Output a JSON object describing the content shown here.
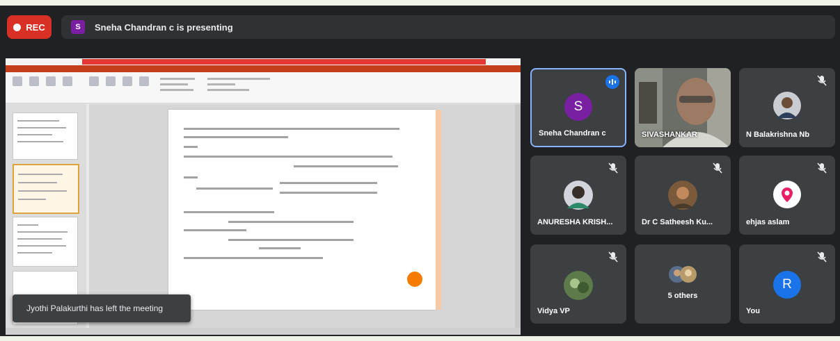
{
  "recording": {
    "label": "REC"
  },
  "presenting": {
    "avatar_initial": "S",
    "text": "Sneha Chandran c is presenting"
  },
  "notification": {
    "text": "Jyothi Palakurthi has left the meeting"
  },
  "participants": [
    {
      "name": "Sneha Chandran c",
      "initial": "S",
      "avatar_color": "#7b1fa2",
      "speaking": true
    },
    {
      "name": "SIVASHANKAR",
      "video": true
    },
    {
      "name": "N Balakrishna Nb"
    },
    {
      "name": "ANURESHA KRISH..."
    },
    {
      "name": "Dr C Satheesh Ku..."
    },
    {
      "name": "ehjas aslam"
    },
    {
      "name": "Vidya VP"
    },
    {
      "name": "5 others"
    },
    {
      "name": "You",
      "initial": "R",
      "avatar_color": "#1a73e8"
    }
  ],
  "colors": {
    "background": "#202124",
    "rec": "#d93025",
    "tile": "#3c4043",
    "active_border": "#8ab4f8"
  },
  "icons": [
    "record-dot-icon",
    "mic-off-icon",
    "speaking-indicator-icon",
    "location-pin-icon"
  ]
}
